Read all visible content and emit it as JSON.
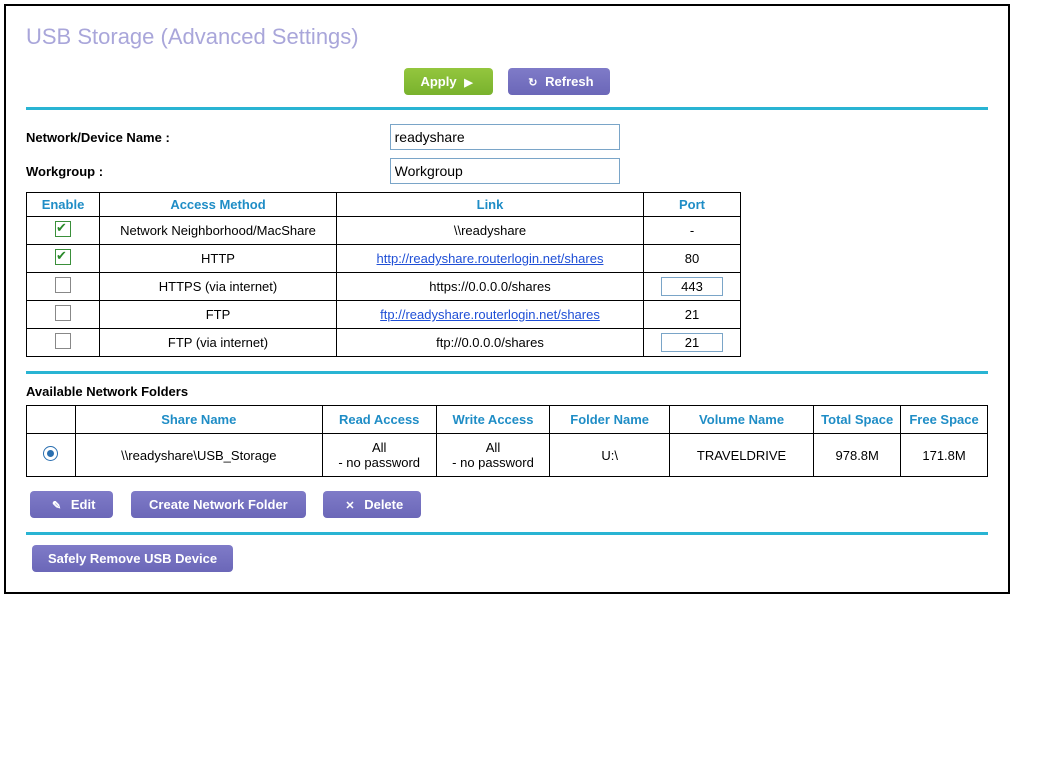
{
  "title": "USB Storage (Advanced Settings)",
  "buttons": {
    "apply": "Apply",
    "refresh": "Refresh",
    "edit": "Edit",
    "create": "Create Network Folder",
    "delete": "Delete",
    "remove": "Safely Remove USB Device"
  },
  "fields": {
    "device_name_label": "Network/Device Name :",
    "device_name_value": "readyshare",
    "workgroup_label": "Workgroup :",
    "workgroup_value": "Workgroup"
  },
  "access_table": {
    "headers": {
      "enable": "Enable",
      "method": "Access Method",
      "link": "Link",
      "port": "Port"
    },
    "rows": [
      {
        "checked": true,
        "method": "Network Neighborhood/MacShare",
        "link_text": "\\\\readyshare",
        "is_link": false,
        "port": "-",
        "port_editable": false
      },
      {
        "checked": true,
        "method": "HTTP",
        "link_text": "http://readyshare.routerlogin.net/shares",
        "is_link": true,
        "port": "80",
        "port_editable": false
      },
      {
        "checked": false,
        "method": "HTTPS (via internet)",
        "link_text": "https://0.0.0.0/shares",
        "is_link": false,
        "port": "443",
        "port_editable": true
      },
      {
        "checked": false,
        "method": "FTP",
        "link_text": "ftp://readyshare.routerlogin.net/shares",
        "is_link": true,
        "port": "21",
        "port_editable": false
      },
      {
        "checked": false,
        "method": "FTP (via internet)",
        "link_text": "ftp://0.0.0.0/shares",
        "is_link": false,
        "port": "21",
        "port_editable": true
      }
    ]
  },
  "folders_title": "Available Network Folders",
  "folders_table": {
    "headers": {
      "select": "",
      "share": "Share Name",
      "read": "Read Access",
      "write": "Write Access",
      "folder": "Folder Name",
      "volume": "Volume Name",
      "total": "Total Space",
      "free": "Free Space"
    },
    "rows": [
      {
        "selected": true,
        "share": "\\\\readyshare\\USB_Storage",
        "read": "All - no password",
        "write": "All - no password",
        "folder": "U:\\",
        "volume": "TRAVELDRIVE",
        "total": "978.8M",
        "free": "171.8M"
      }
    ]
  }
}
